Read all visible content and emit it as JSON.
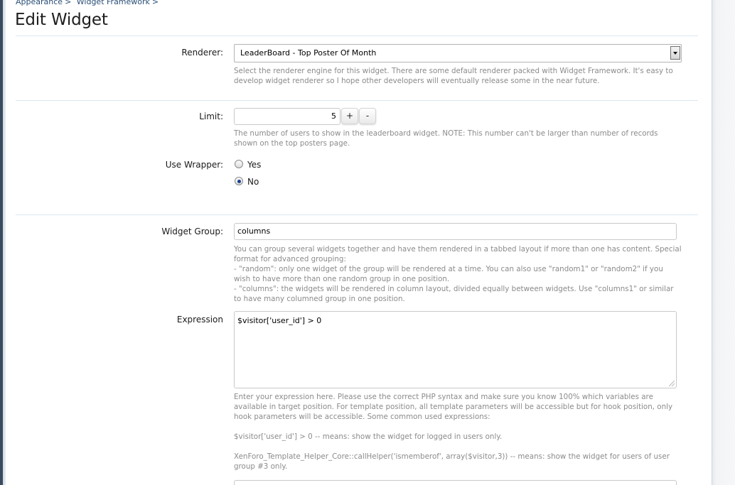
{
  "breadcrumb": [
    {
      "label": "Appearance",
      "sep": ">"
    },
    {
      "label": "Widget Framework",
      "sep": ">"
    }
  ],
  "page_title": "Edit Widget",
  "form": {
    "renderer": {
      "label": "Renderer:",
      "value": "LeaderBoard - Top Poster Of Month",
      "hint": "Select the renderer engine for this widget. There are some default renderer packed with Widget Framework. It's easy to develop widget renderer so I hope other developers will eventually release some in the near future."
    },
    "limit": {
      "label": "Limit:",
      "value": "5",
      "plus": "+",
      "minus": "-",
      "hint": "The number of users to show in the leaderboard widget. NOTE: This number can't be larger than number of records shown on the top posters page."
    },
    "use_wrapper": {
      "label": "Use Wrapper:",
      "options": [
        {
          "label": "Yes",
          "checked": false
        },
        {
          "label": "No",
          "checked": true
        }
      ]
    },
    "widget_group": {
      "label": "Widget Group:",
      "value": "columns",
      "hint_lines": [
        "You can group several widgets together and have them rendered in a tabbed layout if more than one has content. Special format for advanced grouping:",
        "- \"random\": only one widget of the group will be rendered at a time. You can also use \"random1\" or \"random2\" if you wish to have more than one random group in one position.",
        "- \"columns\": the widgets will be rendered in column layout, divided equally between widgets. Use \"columns1\" or similar to have many columned group in one position."
      ]
    },
    "expression": {
      "label": "Expression",
      "value": "$visitor['user_id'] > 0",
      "hint_paragraphs": [
        "Enter your expression here. Please use the correct PHP syntax and make sure you know 100% which variables are available in target position. For template position, all template parameters will be accessible but for hook position, only hook parameters will be accessible. Some common used expressions:",
        "$visitor['user_id'] > 0 -- means: show the widget for logged in users only.",
        "XenForo_Template_Helper_Core::callHelper('ismemberof', array($visitor,3)) -- means: show the widget for users of user group #3 only."
      ]
    }
  }
}
